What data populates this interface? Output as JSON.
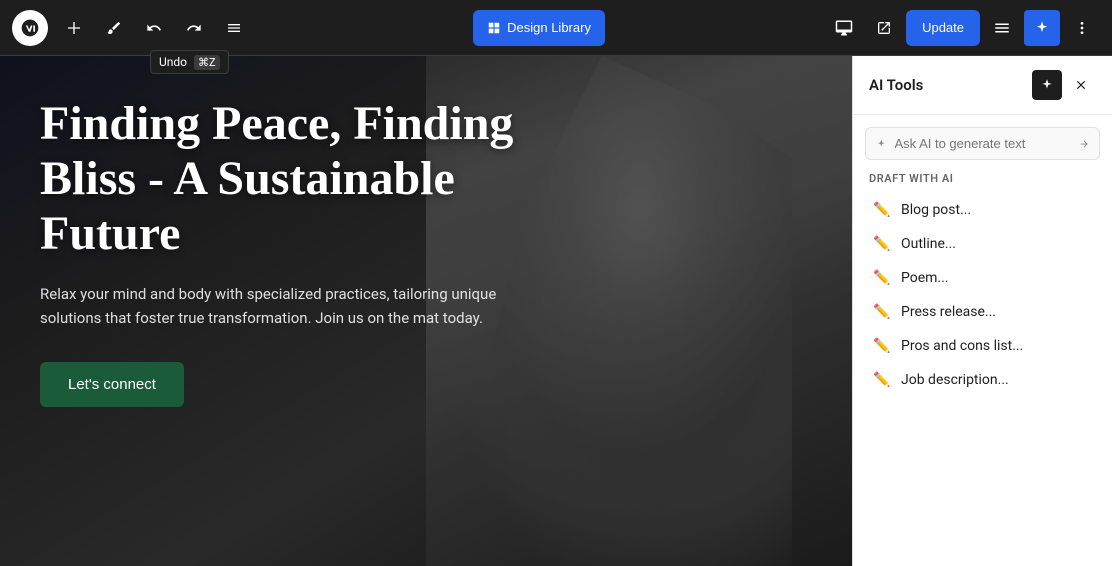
{
  "toolbar": {
    "wp_logo_alt": "WordPress",
    "add_label": "+",
    "brush_label": "✏",
    "undo_label": "↩",
    "redo_label": "↪",
    "list_view_label": "≡",
    "design_library_label": "Design Library",
    "preview_label": "preview",
    "external_label": "external",
    "update_label": "Update",
    "toggle_sidebar_label": "sidebar",
    "ai_tools_label": "AI Tools",
    "more_options_label": "⋯"
  },
  "tooltip": {
    "undo_text": "Undo",
    "undo_kbd": "⌘Z"
  },
  "hero": {
    "title": "Finding Peace, Finding Bliss - A Sustainable Future",
    "subtitle": "Relax your mind and body with specialized practices, tailoring unique solutions that foster true transformation. Join us on the mat today.",
    "cta_label": "Let's connect"
  },
  "ai_panel": {
    "title": "AI Tools",
    "search_placeholder": "Ask AI to generate text",
    "draft_section_label": "DRAFT WITH AI",
    "draft_items": [
      {
        "id": "blog-post",
        "label": "Blog post..."
      },
      {
        "id": "outline",
        "label": "Outline..."
      },
      {
        "id": "poem",
        "label": "Poem..."
      },
      {
        "id": "press-release",
        "label": "Press release..."
      },
      {
        "id": "pros-cons",
        "label": "Pros and cons list..."
      },
      {
        "id": "job-description",
        "label": "Job description..."
      }
    ]
  }
}
